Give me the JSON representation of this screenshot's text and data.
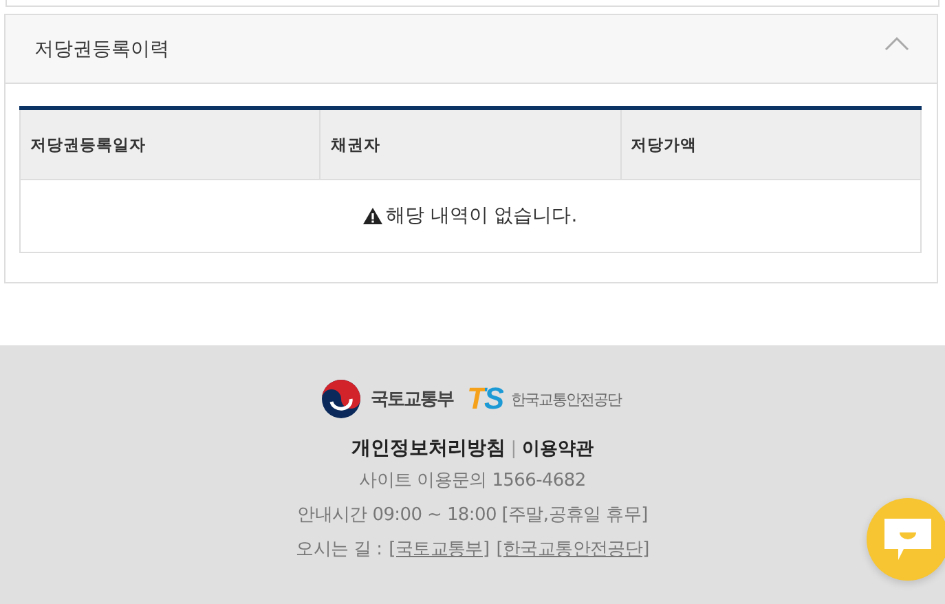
{
  "panel": {
    "title": "저당권등록이력",
    "expanded": true
  },
  "table": {
    "columns": [
      "저당권등록일자",
      "채권자",
      "저당가액"
    ],
    "empty_message": "해당 내역이 없습니다."
  },
  "footer": {
    "ministry": "국토교통부",
    "ts_mark": "TS",
    "agency": "한국교통안전공단",
    "policy_links": [
      "개인정보처리방침",
      "이용약관"
    ],
    "separator": "|",
    "contact": "사이트 이용문의 1566-4682",
    "hours": "안내시간 09:00 ~ 18:00 [주말,공휴일 휴무]",
    "directions_label": "오시는 길 :",
    "direction_links": [
      "[국토교통부]",
      "[한국교통안전공단]"
    ]
  }
}
